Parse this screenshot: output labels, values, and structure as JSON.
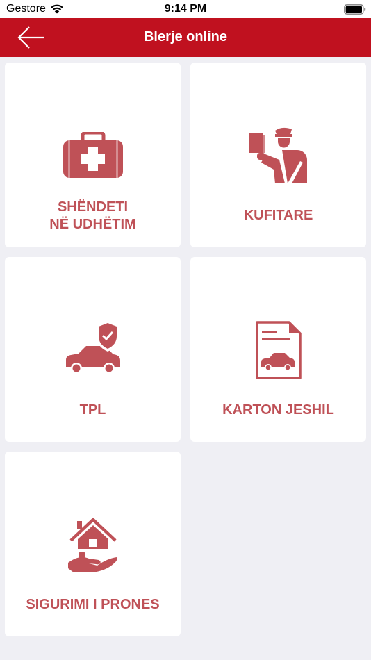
{
  "status_bar": {
    "carrier": "Gestore",
    "time": "9:14 PM",
    "wifi_icon": "wifi-icon",
    "battery_icon": "battery-icon"
  },
  "nav": {
    "title": "Blerje online",
    "back_icon": "arrow-left-icon",
    "background_color": "#c0111f"
  },
  "theme": {
    "accent_color": "#bf5157",
    "background": "#efeff4"
  },
  "cards": [
    {
      "label": "SHËNDETI\nNË UDHËTIM",
      "icon": "first-aid-kit-icon"
    },
    {
      "label": "KUFITARE",
      "icon": "border-officer-icon"
    },
    {
      "label": "TPL",
      "icon": "car-shield-icon"
    },
    {
      "label": "KARTON JESHIL",
      "icon": "green-card-document-icon"
    },
    {
      "label": "SIGURIMI I PRONES",
      "icon": "house-hand-icon"
    }
  ]
}
